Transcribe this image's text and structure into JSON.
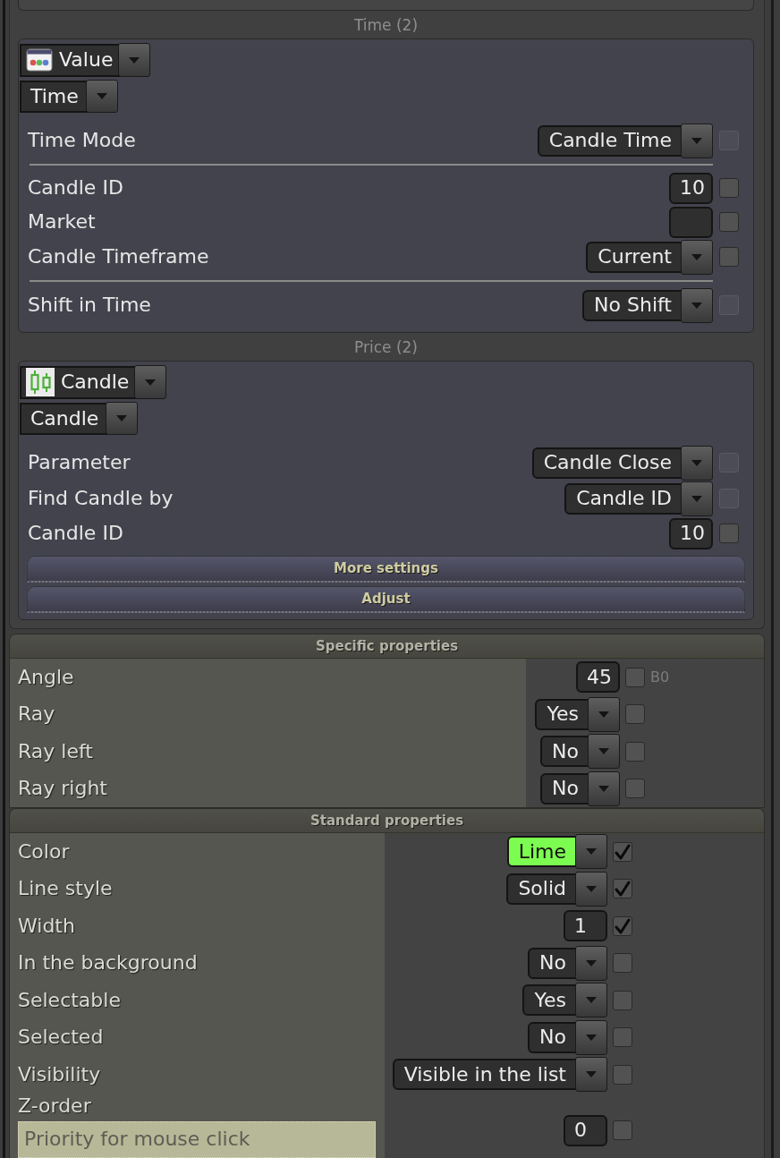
{
  "panel": {
    "groups": [
      {
        "title": "Time (2)",
        "source": {
          "kind": "value",
          "label": "Value"
        },
        "mode": {
          "label": "Time"
        },
        "rows": [
          {
            "label": "Time Mode",
            "kind": "dropdown",
            "value": "Candle Time",
            "divider_above": false,
            "checkbox": {
              "checked": false,
              "disabled": true
            }
          },
          {
            "label": "Candle ID",
            "kind": "input",
            "value": "10",
            "divider_above": true,
            "checkbox": {
              "checked": false,
              "disabled": false
            }
          },
          {
            "label": "Market",
            "kind": "input",
            "divider_above": false,
            "checkbox": {
              "checked": false,
              "disabled": false
            }
          },
          {
            "label": "Candle Timeframe",
            "kind": "dropdown",
            "value": "Current",
            "divider_above": false,
            "checkbox": {
              "checked": false,
              "disabled": false
            }
          },
          {
            "label": "Shift in Time",
            "kind": "dropdown",
            "value": "No Shift",
            "divider_above": true,
            "checkbox": {
              "checked": false,
              "disabled": true
            }
          }
        ]
      },
      {
        "title": "Price (2)",
        "source": {
          "kind": "candle",
          "label": "Candle"
        },
        "mode": {
          "label": "Candle"
        },
        "rows": [
          {
            "label": "Parameter",
            "kind": "dropdown",
            "value": "Candle Close",
            "divider_above": false,
            "checkbox": {
              "checked": false,
              "disabled": true
            }
          },
          {
            "label": "Find Candle by",
            "kind": "dropdown",
            "value": "Candle ID",
            "divider_above": false,
            "checkbox": {
              "checked": false,
              "disabled": true
            }
          },
          {
            "label": "Candle ID",
            "kind": "input",
            "value": "10",
            "divider_above": false,
            "checkbox": {
              "checked": false,
              "disabled": false
            }
          }
        ],
        "buttons": [
          "More settings",
          "Adjust"
        ]
      }
    ]
  },
  "sections": [
    {
      "title": "Specific properties",
      "rows": [
        {
          "label": "Angle",
          "kind": "input",
          "value": "45",
          "checkbox": {
            "checked": false,
            "disabled": false
          },
          "suffix": "B0"
        },
        {
          "label": "Ray",
          "kind": "dropdown",
          "value": "Yes",
          "checkbox": {
            "checked": false,
            "disabled": false
          }
        },
        {
          "label": "Ray left",
          "kind": "dropdown",
          "value": "No",
          "checkbox": {
            "checked": false,
            "disabled": false
          }
        },
        {
          "label": "Ray right",
          "kind": "dropdown",
          "value": "No",
          "checkbox": {
            "checked": false,
            "disabled": false
          }
        }
      ]
    },
    {
      "title": "Standard properties",
      "rows": [
        {
          "label": "Color",
          "kind": "dropdown",
          "value": "Lime",
          "color": "#7cfc50",
          "checkbox": {
            "checked": true,
            "disabled": false
          }
        },
        {
          "label": "Line style",
          "kind": "dropdown",
          "value": "Solid",
          "checkbox": {
            "checked": true,
            "disabled": false
          }
        },
        {
          "label": "Width",
          "kind": "input",
          "value": "1",
          "checkbox": {
            "checked": true,
            "disabled": false
          }
        },
        {
          "label": "In the background",
          "kind": "dropdown",
          "value": "No",
          "checkbox": {
            "checked": false,
            "disabled": false
          }
        },
        {
          "label": "Selectable",
          "kind": "dropdown",
          "value": "Yes",
          "checkbox": {
            "checked": false,
            "disabled": false
          }
        },
        {
          "label": "Selected",
          "kind": "dropdown",
          "value": "No",
          "checkbox": {
            "checked": false,
            "disabled": false
          }
        },
        {
          "label": "Visibility",
          "kind": "dropdown",
          "value": "Visible in the list",
          "checkbox": {
            "checked": false,
            "disabled": false
          }
        },
        {
          "label": "Z-order",
          "hint": "Priority for mouse click",
          "kind": "input",
          "value": "0",
          "checkbox": {
            "checked": false,
            "disabled": false
          }
        }
      ]
    }
  ]
}
